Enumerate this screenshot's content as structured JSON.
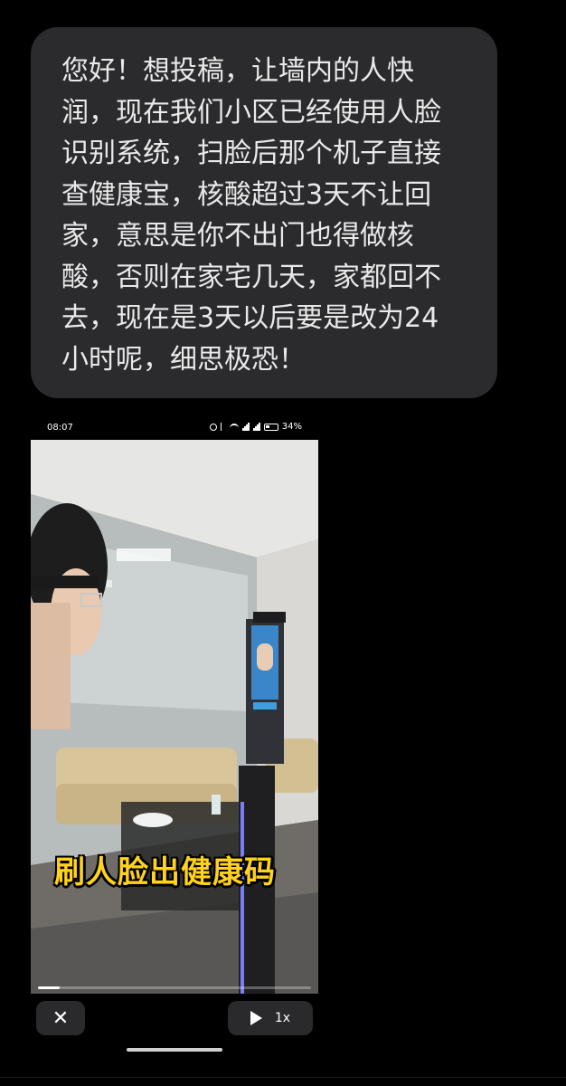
{
  "message": {
    "text": "您好！想投稿，让墙内的人快\n润，现在我们小区已经使用人脸\n识别系统，扫脸后那个机子直接\n查健康宝，核酸超过3天不让回\n家，意思是你不出门也得做核\n酸，否则在家宅几天，家都回不\n去，现在是3天以后要是改为24\n小时呢，细思极恐！"
  },
  "video": {
    "status_bar": {
      "time": "08:07",
      "battery": "34%"
    },
    "caption": "刷人脸出健康码",
    "progress": 0.08,
    "speed_label": "1x",
    "close_label": "✕"
  },
  "colors": {
    "bubble_bg": "#2b2b2d",
    "caption": "#ffd21c",
    "background": "#000000"
  }
}
